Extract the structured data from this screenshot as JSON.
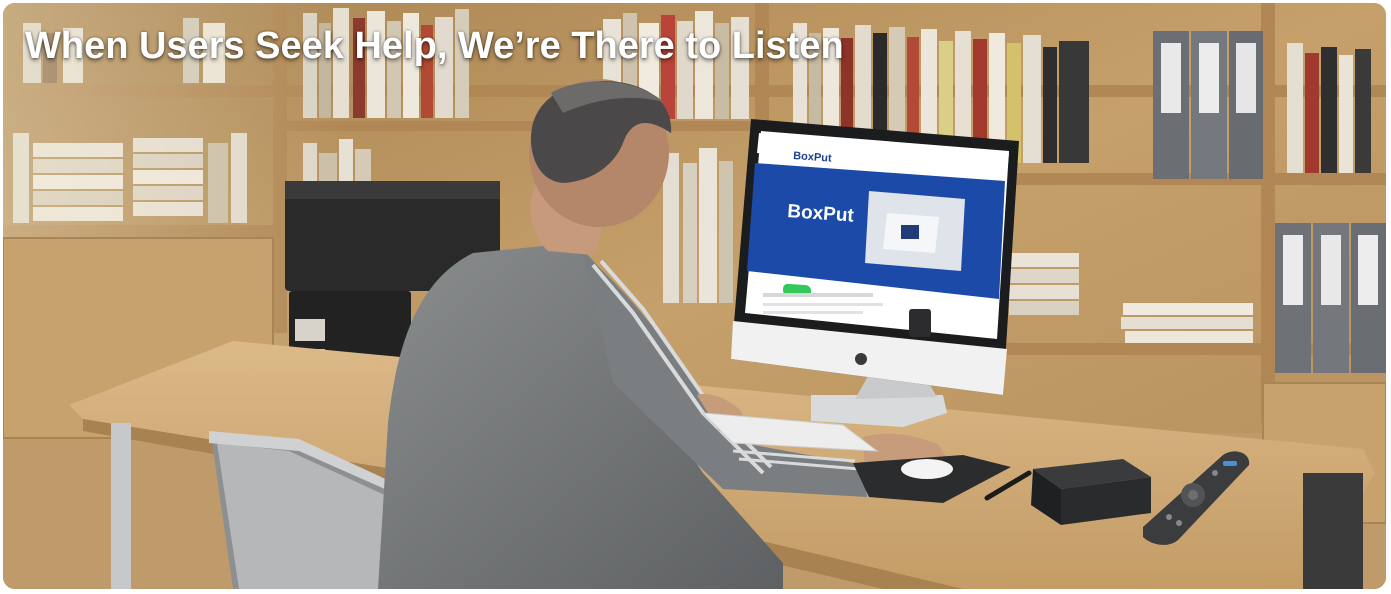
{
  "banner": {
    "headline": "When Users Seek Help, We’re There to Listen"
  },
  "monitor_screen": {
    "brand_nav": "BoxPut",
    "hero_logo": "BoxPut"
  },
  "colors": {
    "shelf_wood": "#c9a46c",
    "desk_wood": "#cfa872",
    "hero_blue": "#1c4aa8",
    "cta_green": "#34c759",
    "headline_text": "#ffffff"
  }
}
